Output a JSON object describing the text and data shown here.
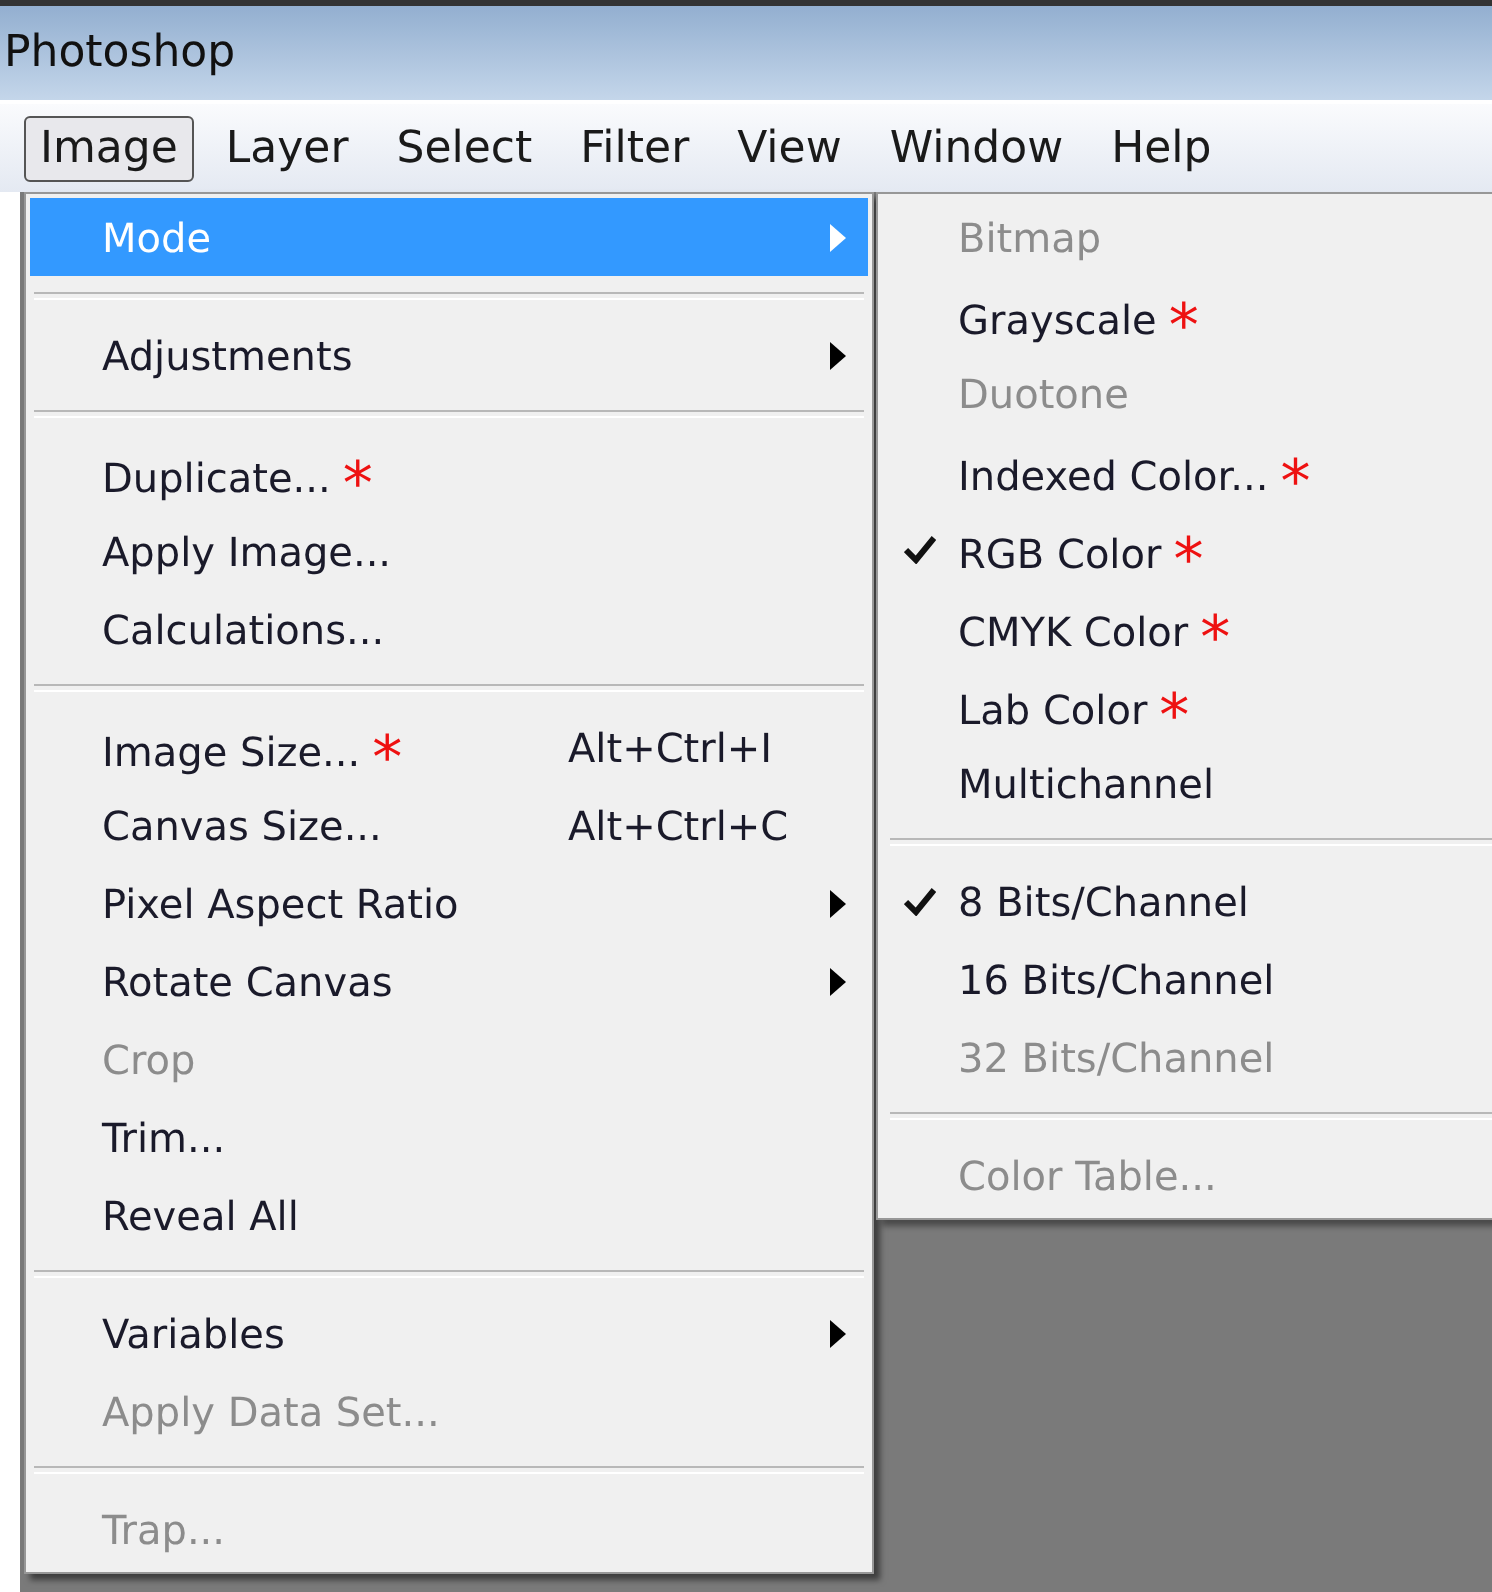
{
  "window": {
    "title": "Photoshop"
  },
  "menu_bar": [
    {
      "label": "Image",
      "selected": true
    },
    {
      "label": "Layer",
      "selected": false
    },
    {
      "label": "Select",
      "selected": false
    },
    {
      "label": "Filter",
      "selected": false
    },
    {
      "label": "View",
      "selected": false
    },
    {
      "label": "Window",
      "selected": false
    },
    {
      "label": "Help",
      "selected": false
    }
  ],
  "image_menu": [
    {
      "kind": "item",
      "label": "Mode",
      "selected": true,
      "disabled": false,
      "has_submenu": true
    },
    {
      "kind": "separator"
    },
    {
      "kind": "item",
      "label": "Adjustments",
      "selected": false,
      "disabled": false,
      "has_submenu": true
    },
    {
      "kind": "separator"
    },
    {
      "kind": "item",
      "label": "Duplicate...",
      "annotation": "*",
      "selected": false,
      "disabled": false,
      "has_submenu": false
    },
    {
      "kind": "item",
      "label": "Apply Image...",
      "selected": false,
      "disabled": false,
      "has_submenu": false
    },
    {
      "kind": "item",
      "label": "Calculations...",
      "selected": false,
      "disabled": false,
      "has_submenu": false
    },
    {
      "kind": "separator"
    },
    {
      "kind": "item",
      "label": "Image Size...",
      "annotation": "*",
      "shortcut": "Alt+Ctrl+I",
      "selected": false,
      "disabled": false,
      "has_submenu": false
    },
    {
      "kind": "item",
      "label": "Canvas Size...",
      "shortcut": "Alt+Ctrl+C",
      "selected": false,
      "disabled": false,
      "has_submenu": false
    },
    {
      "kind": "item",
      "label": "Pixel Aspect Ratio",
      "selected": false,
      "disabled": false,
      "has_submenu": true
    },
    {
      "kind": "item",
      "label": "Rotate Canvas",
      "selected": false,
      "disabled": false,
      "has_submenu": true
    },
    {
      "kind": "item",
      "label": "Crop",
      "selected": false,
      "disabled": true,
      "has_submenu": false
    },
    {
      "kind": "item",
      "label": "Trim...",
      "selected": false,
      "disabled": false,
      "has_submenu": false
    },
    {
      "kind": "item",
      "label": "Reveal All",
      "selected": false,
      "disabled": false,
      "has_submenu": false
    },
    {
      "kind": "separator"
    },
    {
      "kind": "item",
      "label": "Variables",
      "selected": false,
      "disabled": false,
      "has_submenu": true
    },
    {
      "kind": "item",
      "label": "Apply Data Set...",
      "selected": false,
      "disabled": true,
      "has_submenu": false
    },
    {
      "kind": "separator"
    },
    {
      "kind": "item",
      "label": "Trap...",
      "selected": false,
      "disabled": true,
      "has_submenu": false
    }
  ],
  "mode_submenu": [
    {
      "kind": "item",
      "label": "Bitmap",
      "checked": false,
      "disabled": true
    },
    {
      "kind": "item",
      "label": "Grayscale",
      "annotation": "*",
      "checked": false,
      "disabled": false
    },
    {
      "kind": "item",
      "label": "Duotone",
      "checked": false,
      "disabled": true
    },
    {
      "kind": "item",
      "label": "Indexed Color...",
      "annotation": "*",
      "checked": false,
      "disabled": false
    },
    {
      "kind": "item",
      "label": "RGB Color",
      "annotation": "*",
      "checked": true,
      "disabled": false
    },
    {
      "kind": "item",
      "label": "CMYK Color",
      "annotation": "*",
      "checked": false,
      "disabled": false
    },
    {
      "kind": "item",
      "label": "Lab Color",
      "annotation": "*",
      "checked": false,
      "disabled": false
    },
    {
      "kind": "item",
      "label": "Multichannel",
      "checked": false,
      "disabled": false
    },
    {
      "kind": "separator"
    },
    {
      "kind": "item",
      "label": "8 Bits/Channel",
      "checked": true,
      "disabled": false
    },
    {
      "kind": "item",
      "label": "16 Bits/Channel",
      "checked": false,
      "disabled": false
    },
    {
      "kind": "item",
      "label": "32 Bits/Channel",
      "checked": false,
      "disabled": true
    },
    {
      "kind": "separator"
    },
    {
      "kind": "item",
      "label": "Color Table...",
      "checked": false,
      "disabled": true
    }
  ]
}
